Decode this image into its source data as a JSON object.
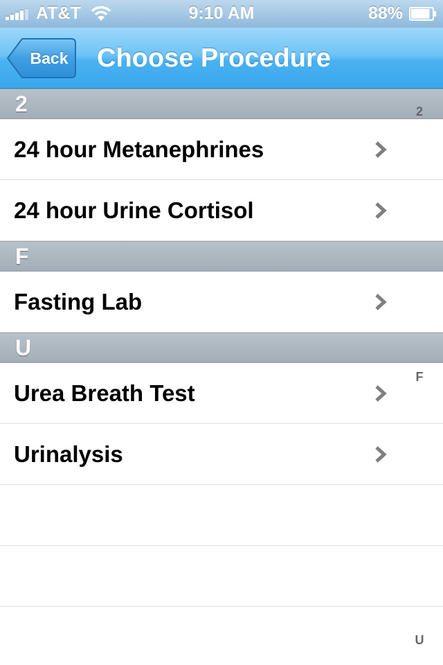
{
  "status_bar": {
    "carrier": "AT&T",
    "time": "9:10 AM",
    "battery_percent": "88%",
    "battery_level": 0.88,
    "signal_icon": "signal-bars-icon",
    "wifi_icon": "wifi-icon",
    "battery_icon": "battery-icon"
  },
  "nav_bar": {
    "back_label": "Back",
    "title": "Choose Procedure"
  },
  "sections": [
    {
      "header": "2",
      "items": [
        "24 hour Metanephrines",
        "24 hour Urine Cortisol"
      ]
    },
    {
      "header": "F",
      "items": [
        "Fasting Lab"
      ]
    },
    {
      "header": "U",
      "items": [
        "Urea Breath Test",
        "Urinalysis"
      ]
    }
  ],
  "section_index": [
    "2",
    "F",
    "U"
  ],
  "colors": {
    "nav_bar": "#49b2f1",
    "section_header": "#a9b3bc",
    "chevron": "#7f7f7f"
  }
}
